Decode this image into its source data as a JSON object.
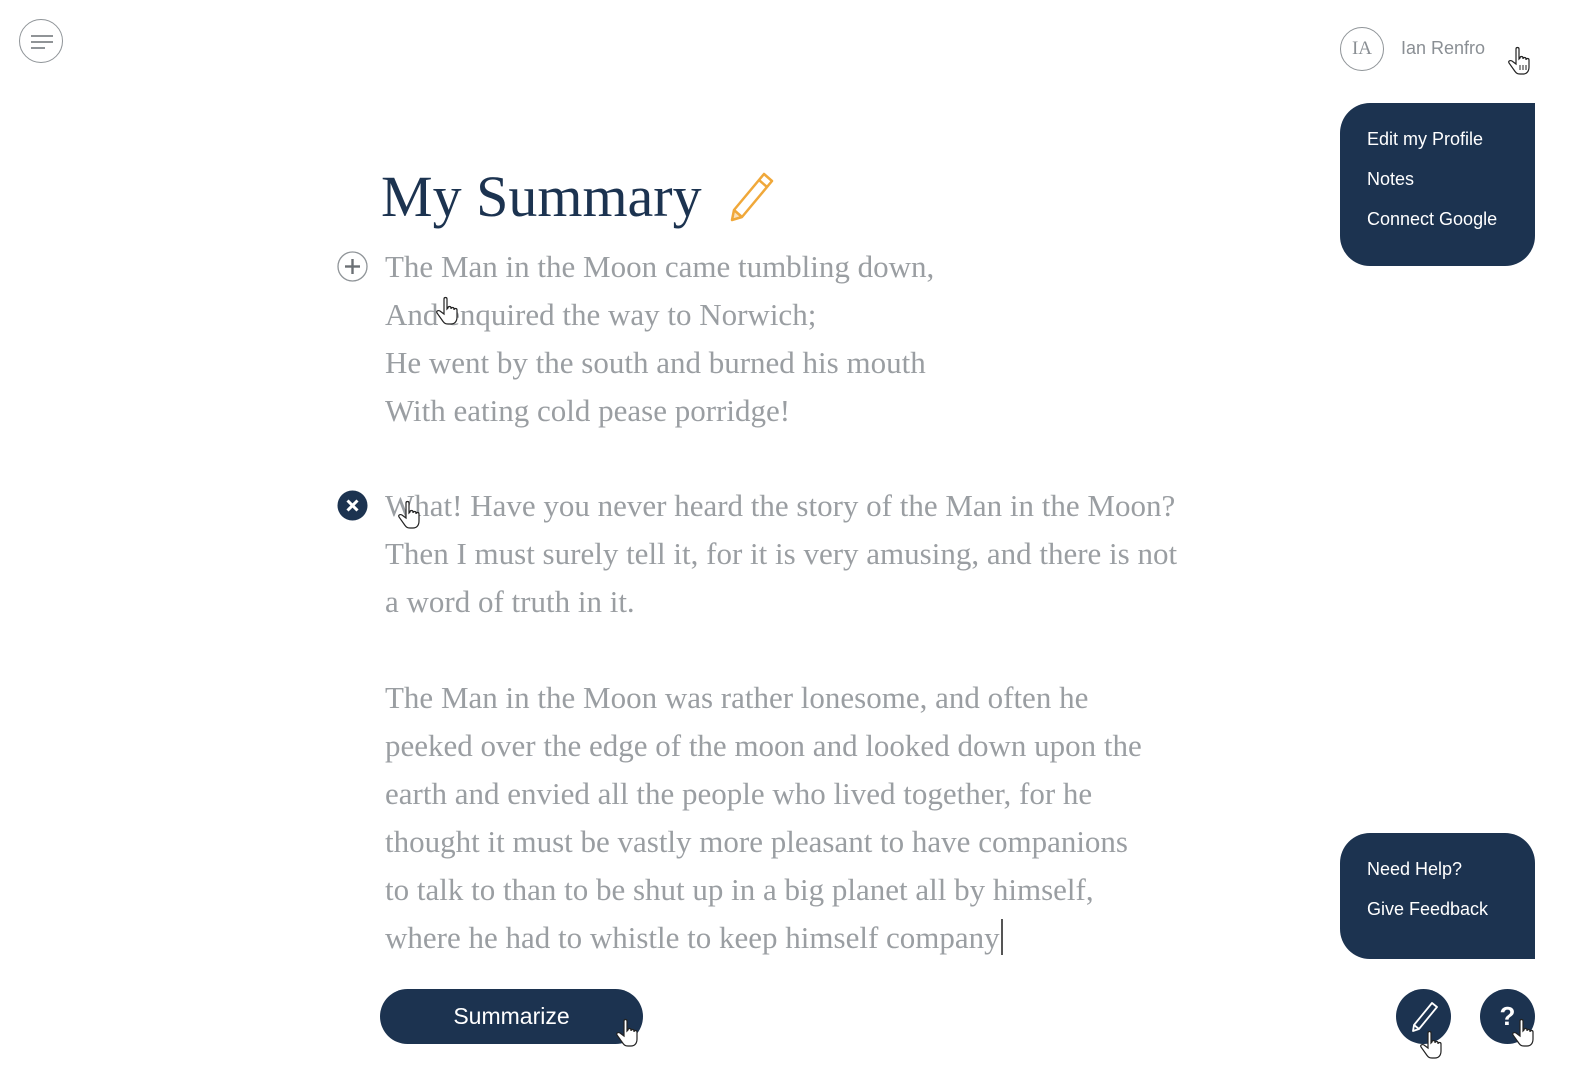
{
  "header": {
    "menu_icon": "hamburger-menu-icon",
    "user": {
      "initials": "IA",
      "name": "Ian Renfro"
    }
  },
  "user_menu": {
    "items": [
      {
        "label": "Edit my Profile"
      },
      {
        "label": "Notes"
      },
      {
        "label": "Connect Google"
      }
    ]
  },
  "help_menu": {
    "items": [
      {
        "label": "Need Help?"
      },
      {
        "label": "Give Feedback"
      }
    ]
  },
  "main": {
    "title": "My Summary",
    "title_edit_icon": "pencil-icon",
    "paragraphs": [
      {
        "text": "The Man in the Moon came tumbling down,\nAnd enquired the way to Norwich;\nHe went by the south and burned his mouth\nWith eating cold pease porridge!",
        "control_icon": "plus-circle-icon"
      },
      {
        "text": "What! Have you never heard the story of the Man in the Moon?\nThen I must surely tell it, for it is very amusing, and there is not\na word of truth in it.",
        "control_icon": "close-circle-icon"
      },
      {
        "text": "The Man in the Moon was rather lonesome, and often he\npeeked over the edge of the moon and looked down upon the\nearth and envied all the people who lived together, for he\nthought it must be vastly more pleasant to have companions\nto talk to than to be shut up in a big planet all by himself,\nwhere he had to whistle to keep himself company"
      }
    ],
    "summarize_label": "Summarize"
  },
  "fabs": {
    "edit_icon": "pencil-icon",
    "help_label": "?"
  },
  "colors": {
    "navy": "#1c3350",
    "text_gray": "#9a9ea2",
    "accent_orange": "#f0a83a"
  }
}
